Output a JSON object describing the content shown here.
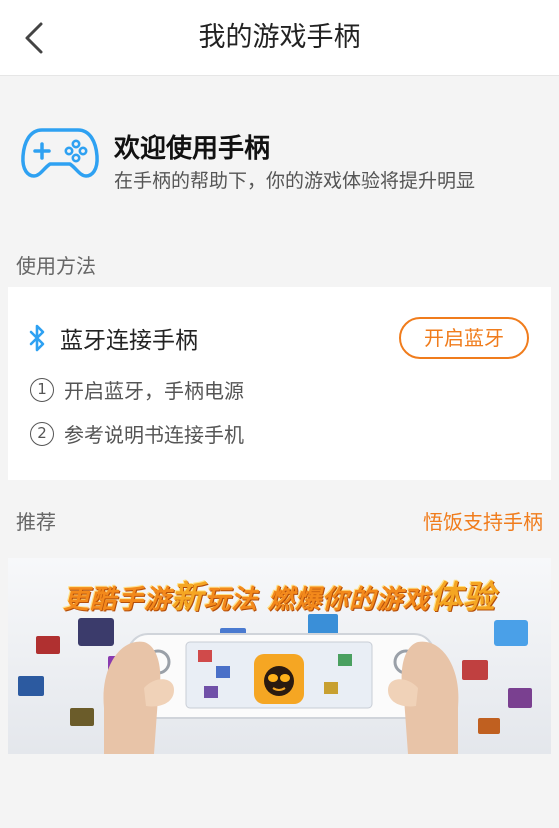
{
  "nav": {
    "title": "我的游戏手柄"
  },
  "welcome": {
    "title": "欢迎使用手柄",
    "subtitle": "在手柄的帮助下，你的游戏体验将提升明显"
  },
  "howto": {
    "section_label": "使用方法",
    "bluetooth_label": "蓝牙连接手柄",
    "open_button": "开启蓝牙",
    "steps": [
      {
        "num": "1",
        "text": "开启蓝牙，手柄电源"
      },
      {
        "num": "2",
        "text": "参考说明书连接手机"
      }
    ]
  },
  "recommend": {
    "section_label": "推荐",
    "link": "悟饭支持手柄",
    "banner": {
      "part1": "更酷手游",
      "part2": "新",
      "part3": "玩法 燃爆你的游戏",
      "part4": "体验"
    }
  },
  "colors": {
    "accent": "#f07c1c",
    "icon_blue": "#2ea1f2"
  }
}
